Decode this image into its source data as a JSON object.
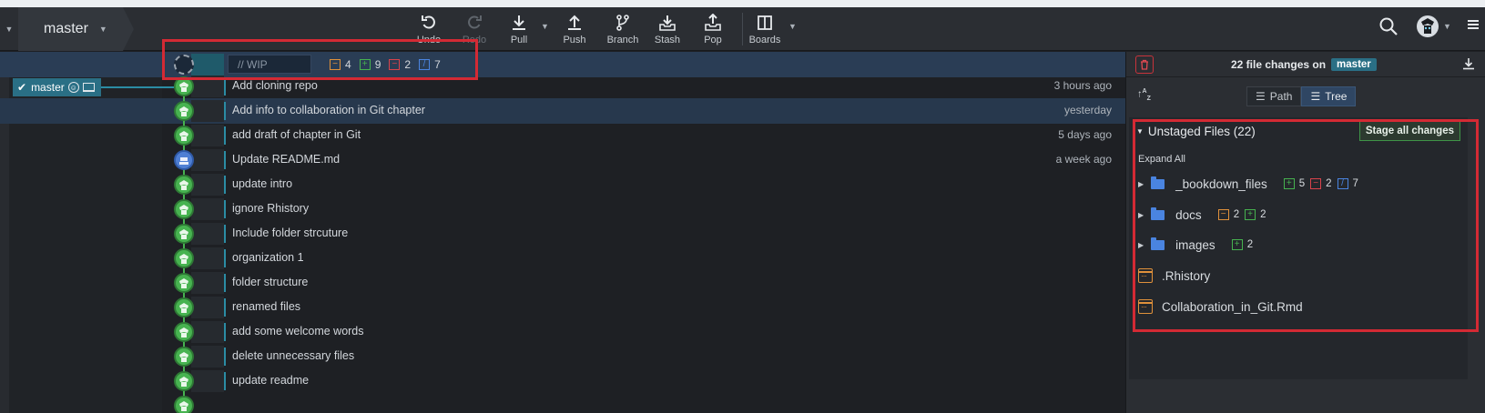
{
  "toolbar": {
    "branch": "master",
    "buttons": [
      {
        "label": "Undo",
        "icon": "undo-icon",
        "enabled": true
      },
      {
        "label": "Redo",
        "icon": "redo-icon",
        "enabled": false
      },
      {
        "label": "Pull",
        "icon": "pull-icon",
        "enabled": true
      },
      {
        "label": "Push",
        "icon": "push-icon",
        "enabled": true
      },
      {
        "label": "Branch",
        "icon": "branch-icon",
        "enabled": true
      },
      {
        "label": "Stash",
        "icon": "stash-icon",
        "enabled": true
      },
      {
        "label": "Pop",
        "icon": "pop-icon",
        "enabled": true
      },
      {
        "label": "Boards",
        "icon": "boards-icon",
        "enabled": true
      }
    ]
  },
  "wip": {
    "placeholder": "// WIP",
    "stats": {
      "modified": "4",
      "added": "9",
      "deleted": "2",
      "renamed": "7"
    }
  },
  "branch_tag": {
    "label": "master"
  },
  "commits": [
    {
      "message": "Add cloning repo",
      "time": "3 hours ago"
    },
    {
      "message": "Add info to collaboration in Git chapter",
      "time": "yesterday"
    },
    {
      "message": "add draft of chapter in Git",
      "time": "5 days ago"
    },
    {
      "message": "Update README.md",
      "time": "a week ago"
    },
    {
      "message": "update intro",
      "time": ""
    },
    {
      "message": "ignore Rhistory",
      "time": ""
    },
    {
      "message": "Include folder strcuture",
      "time": ""
    },
    {
      "message": "organization 1",
      "time": ""
    },
    {
      "message": "folder structure",
      "time": ""
    },
    {
      "message": "renamed files",
      "time": ""
    },
    {
      "message": "add some welcome words",
      "time": ""
    },
    {
      "message": "delete unnecessary files",
      "time": ""
    },
    {
      "message": "update readme",
      "time": ""
    }
  ],
  "right_panel": {
    "title_prefix": "22 file changes on",
    "branch": "master",
    "view_path": "Path",
    "view_tree": "Tree",
    "active_view": "Tree",
    "unstaged_title": "Unstaged Files (22)",
    "stage_all": "Stage all changes",
    "expand_all": "Expand All",
    "folders": [
      {
        "name": "_bookdown_files",
        "stats": [
          {
            "kind": "added",
            "n": "5"
          },
          {
            "kind": "deleted",
            "n": "2"
          },
          {
            "kind": "renamed",
            "n": "7"
          }
        ]
      },
      {
        "name": "docs",
        "stats": [
          {
            "kind": "modified",
            "n": "2"
          },
          {
            "kind": "added",
            "n": "2"
          }
        ]
      },
      {
        "name": "images",
        "stats": [
          {
            "kind": "added",
            "n": "2"
          }
        ]
      }
    ],
    "files": [
      ".Rhistory",
      "Collaboration_in_Git.Rmd"
    ]
  },
  "colors": {
    "modified": "#e0913b",
    "added": "#46b24f",
    "deleted": "#d9434b",
    "renamed": "#4a84e0",
    "highlight": "#d42a34",
    "branch": "#2a6f85"
  }
}
